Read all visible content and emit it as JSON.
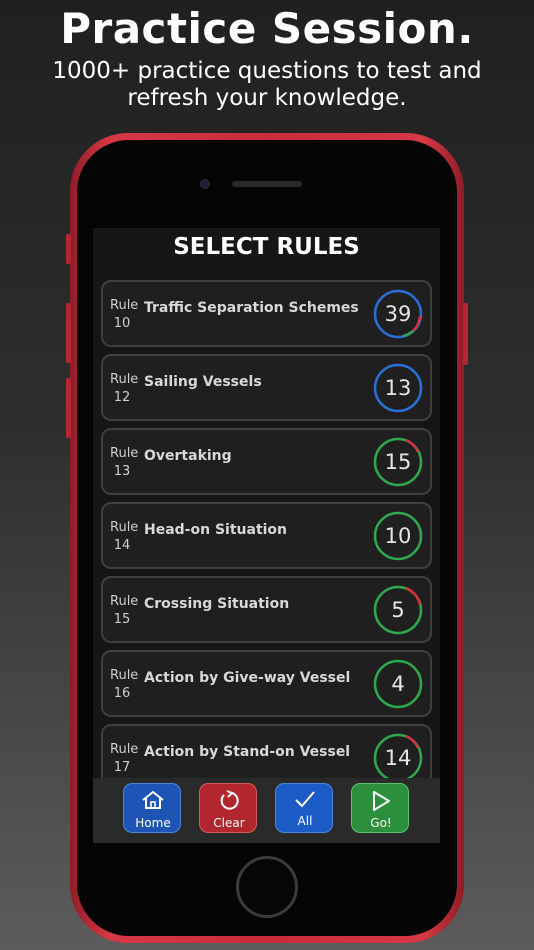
{
  "promo": {
    "headline": "Practice Session.",
    "subline": "1000+ practice questions to test and refresh your knowledge."
  },
  "screen": {
    "title": "SELECT RULES",
    "rule_word": "Rule",
    "rules": [
      {
        "number": "10",
        "name": "Traffic Separation Schemes",
        "count": "39",
        "ring": "blue",
        "accent": [
          "red",
          "green"
        ]
      },
      {
        "number": "12",
        "name": "Sailing Vessels",
        "count": "13",
        "ring": "blue",
        "accent": []
      },
      {
        "number": "13",
        "name": "Overtaking",
        "count": "15",
        "ring": "green",
        "accent": [
          "red"
        ]
      },
      {
        "number": "14",
        "name": "Head-on Situation",
        "count": "10",
        "ring": "green",
        "accent": []
      },
      {
        "number": "15",
        "name": "Crossing Situation",
        "count": "5",
        "ring": "green",
        "accent": [
          "red"
        ]
      },
      {
        "number": "16",
        "name": "Action by Give-way Vessel",
        "count": "4",
        "ring": "green",
        "accent": []
      },
      {
        "number": "17",
        "name": "Action by Stand-on Vessel",
        "count": "14",
        "ring": "green",
        "accent": [
          "red"
        ]
      }
    ]
  },
  "toolbar": {
    "home_label": "Home",
    "clear_label": "Clear",
    "all_label": "All",
    "go_label": "Go!"
  },
  "colors": {
    "ring_blue": "#2b6fd6",
    "ring_green": "#2fa84f",
    "ring_red": "#d6303c",
    "home_btn": "#1e55b5",
    "clear_btn": "#b1272d",
    "all_btn": "#1d5cc6",
    "go_btn": "#2c8f3c"
  }
}
